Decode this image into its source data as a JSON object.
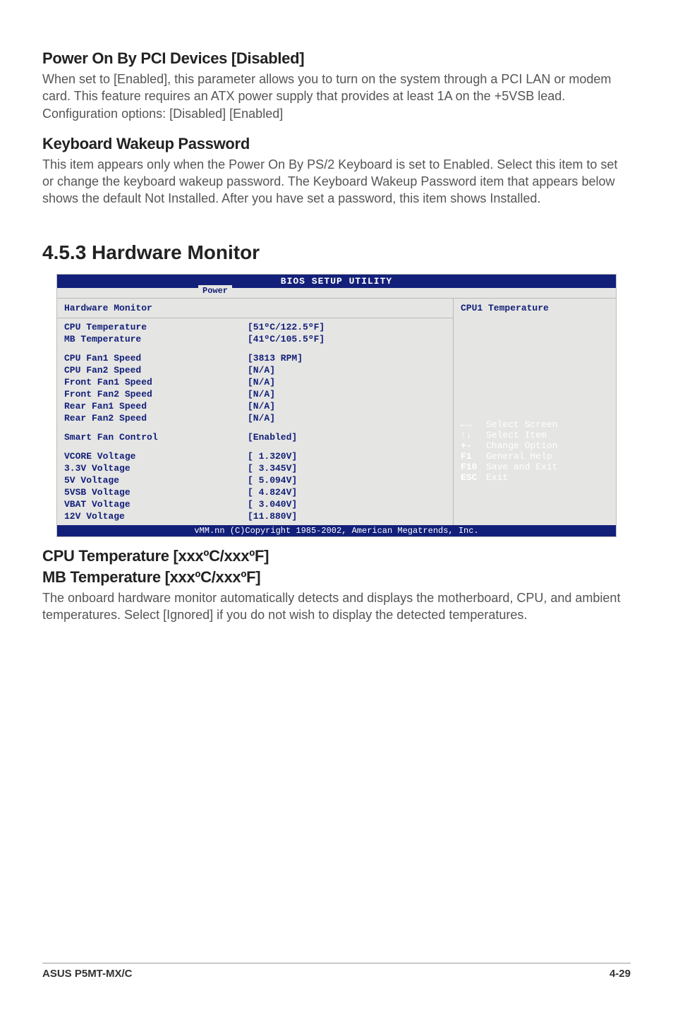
{
  "sections": {
    "poweron": {
      "heading": "Power On By PCI Devices [Disabled]",
      "body": "When set to [Enabled], this parameter allows you to turn on the system through a PCI LAN or modem card. This feature requires an ATX power supply that provides at least 1A on the +5VSB lead. Configuration options: [Disabled] [Enabled]"
    },
    "kbwakeup": {
      "heading": "Keyboard Wakeup Password",
      "body": "This item appears only when the Power On By PS/2 Keyboard is set to Enabled.  Select this item to set or change the keyboard wakeup password. The Keyboard Wakeup Password item that appears below shows the default Not Installed. After you have set a password, this item shows Installed."
    },
    "hwmon_heading": "4.5.3   Hardware Monitor",
    "cputemp": {
      "heading1": "CPU Temperature [xxxºC/xxxºF]",
      "heading2": "MB Temperature [xxxºC/xxxºF]",
      "body": "The onboard hardware monitor automatically detects and displays the motherboard, CPU, and ambient temperatures. Select [Ignored] if you do not wish to display the detected temperatures."
    }
  },
  "bios": {
    "title": "BIOS SETUP UTILITY",
    "tab": "Power",
    "panel_title": "Hardware Monitor",
    "right_title": "CPU1 Temperature",
    "rows": [
      {
        "label": "CPU Temperature",
        "value": "[51ºC/122.5ºF]"
      },
      {
        "label": "MB Temperature",
        "value": "[41ºC/105.5ºF]"
      }
    ],
    "fan_rows": [
      {
        "label": "CPU Fan1 Speed",
        "value": "[3813 RPM]"
      },
      {
        "label": "CPU Fan2 Speed",
        "value": "[N/A]"
      },
      {
        "label": "Front Fan1 Speed",
        "value": "[N/A]"
      },
      {
        "label": "Front Fan2 Speed",
        "value": "[N/A]"
      },
      {
        "label": "Rear Fan1 Speed",
        "value": "[N/A]"
      },
      {
        "label": "Rear Fan2 Speed",
        "value": "[N/A]"
      }
    ],
    "smart_fan": {
      "label": "Smart Fan Control",
      "value": "[Enabled]"
    },
    "volt_rows": [
      {
        "label": "VCORE Voltage",
        "value": "[ 1.320V]"
      },
      {
        "label": "3.3V Voltage",
        "value": "[ 3.345V]"
      },
      {
        "label": "5V Voltage",
        "value": "[ 5.094V]"
      },
      {
        "label": "5VSB Voltage",
        "value": "[ 4.824V]"
      },
      {
        "label": "VBAT Voltage",
        "value": "[ 3.040V]"
      },
      {
        "label": "12V Voltage",
        "value": "[11.880V]"
      }
    ],
    "help_keys": [
      {
        "k": "←→",
        "v": "Select Screen"
      },
      {
        "k": "↑↓",
        "v": "Select Item"
      },
      {
        "k": "+-",
        "v": "Change Option"
      },
      {
        "k": "F1",
        "v": "General Help"
      },
      {
        "k": "F10",
        "v": "Save and Exit"
      },
      {
        "k": "ESC",
        "v": "Exit"
      }
    ],
    "footer": "vMM.nn (C)Copyright 1985-2002, American Megatrends, Inc."
  },
  "page_footer": {
    "left": "ASUS P5MT-MX/C",
    "right": "4-29"
  }
}
